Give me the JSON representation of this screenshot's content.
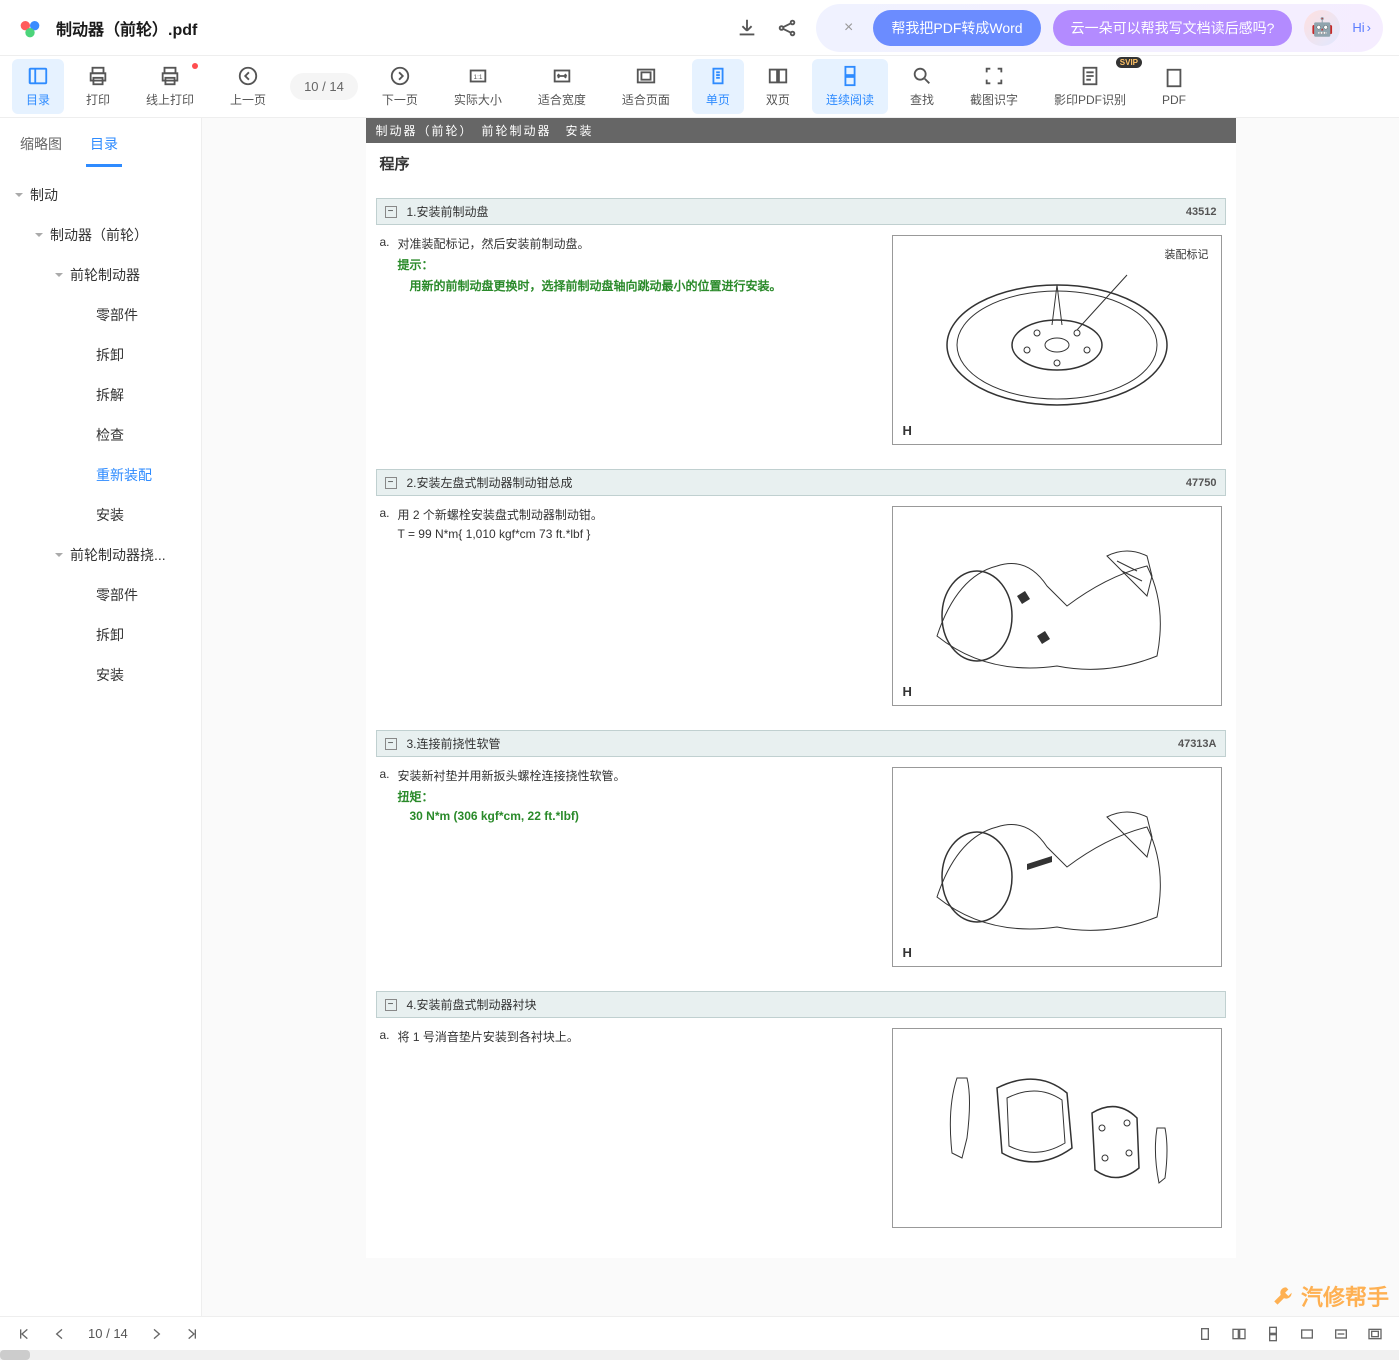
{
  "header": {
    "file_title": "制动器（前轮）.pdf",
    "promo_btn1": "帮我把PDF转成Word",
    "promo_btn2": "云一朵可以帮我写文档读后感吗?",
    "hi_label": "Hi"
  },
  "toolbar": {
    "catalog": "目录",
    "print": "打印",
    "online_print": "线上打印",
    "prev": "上一页",
    "page_current": "10",
    "page_sep": "/ 14",
    "next": "下一页",
    "actual_size": "实际大小",
    "fit_width": "适合宽度",
    "fit_page": "适合页面",
    "single": "单页",
    "double": "双页",
    "continuous": "连续阅读",
    "find": "查找",
    "ocr_crop": "截图识字",
    "pdf_ocr": "影印PDF识别",
    "svip": "SVIP",
    "pdf_more": "PDF"
  },
  "sidebar": {
    "tab_thumb": "缩略图",
    "tab_toc": "目录",
    "tree": {
      "n1": "制动",
      "n2": "制动器（前轮）",
      "n3": "前轮制动器",
      "n3_1": "零部件",
      "n3_2": "拆卸",
      "n3_3": "拆解",
      "n3_4": "检查",
      "n3_5": "重新装配",
      "n3_6": "安装",
      "n4": "前轮制动器挠...",
      "n4_1": "零部件",
      "n4_2": "拆卸",
      "n4_3": "安装"
    }
  },
  "document": {
    "breadcrumb": "制动器（前轮）　前轮制动器　安装",
    "procedure_title": "程序",
    "steps": [
      {
        "title": "1.安装前制动盘",
        "code": "43512",
        "letter": "a.",
        "text1": "对准装配标记，然后安装前制动盘。",
        "hint_label": "提示：",
        "hint_text": "用新的前制动盘更换时，选择前制动盘轴向跳动最小的位置进行安装。",
        "fig_label": "装配标记"
      },
      {
        "title": "2.安装左盘式制动器制动钳总成",
        "code": "47750",
        "letter": "a.",
        "text1": "用 2 个新螺栓安装盘式制动器制动钳。",
        "text2": "T = 99 N*m{ 1,010 kgf*cm 73 ft.*lbf }"
      },
      {
        "title": "3.连接前挠性软管",
        "code": "47313A",
        "letter": "a.",
        "text1": "安装新衬垫并用新扳头螺栓连接挠性软管。",
        "torque_label": "扭矩：",
        "torque_value": "30 N*m (306 kgf*cm, 22 ft.*lbf)"
      },
      {
        "title": "4.安装前盘式制动器衬块",
        "code": "",
        "letter": "a.",
        "text1": "将 1 号消音垫片安装到各衬块上。"
      }
    ]
  },
  "footer": {
    "page_current": "10",
    "page_sep": "/ 14",
    "watermark": "汽修帮手"
  }
}
